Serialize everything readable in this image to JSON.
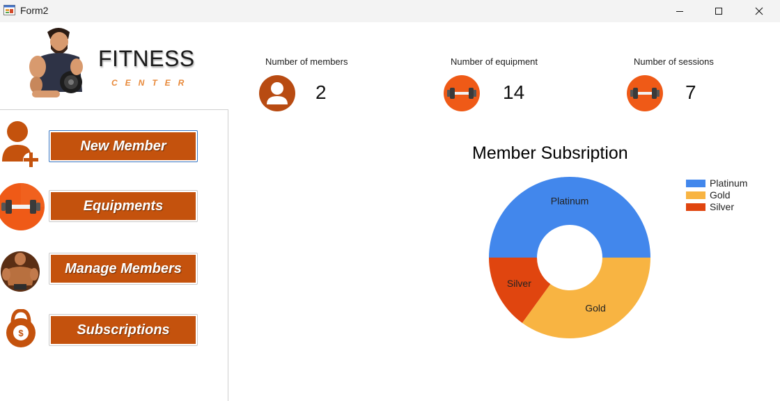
{
  "window": {
    "title": "Form2",
    "icons": {
      "app": "form-icon",
      "minimize": "minimize-icon",
      "maximize": "maximize-icon",
      "close": "close-icon"
    }
  },
  "logo": {
    "title": "FITNESS",
    "subtitle": "CENTER",
    "image": "bodybuilder-dumbbell-logo"
  },
  "sidebar": {
    "items": [
      {
        "label": "New Member",
        "icon": "add-user-icon"
      },
      {
        "label": "Equipments",
        "icon": "dumbbell-icon"
      },
      {
        "label": "Manage Members",
        "icon": "bodybuilder-icon"
      },
      {
        "label": "Subscriptions",
        "icon": "kettlebell-dollar-icon"
      }
    ]
  },
  "stats": [
    {
      "label": "Number of members",
      "value": "2",
      "icon": "user-icon"
    },
    {
      "label": "Number of equipment",
      "value": "14",
      "icon": "dumbbell-icon"
    },
    {
      "label": "Number of sessions",
      "value": "7",
      "icon": "dumbbell-icon"
    }
  ],
  "colors": {
    "accent": "#c4520d",
    "icon_orange": "#ef5a17",
    "platinum": "#4287ec",
    "gold": "#f8b442",
    "silver": "#e0450f"
  },
  "chart_data": {
    "type": "pie",
    "variant": "doughnut",
    "title": "Member Subsription",
    "categories": [
      "Platinum",
      "Gold",
      "Silver"
    ],
    "values": [
      50,
      35,
      15
    ],
    "colors": [
      "#4287ec",
      "#f8b442",
      "#e0450f"
    ],
    "legend": "top-right"
  }
}
